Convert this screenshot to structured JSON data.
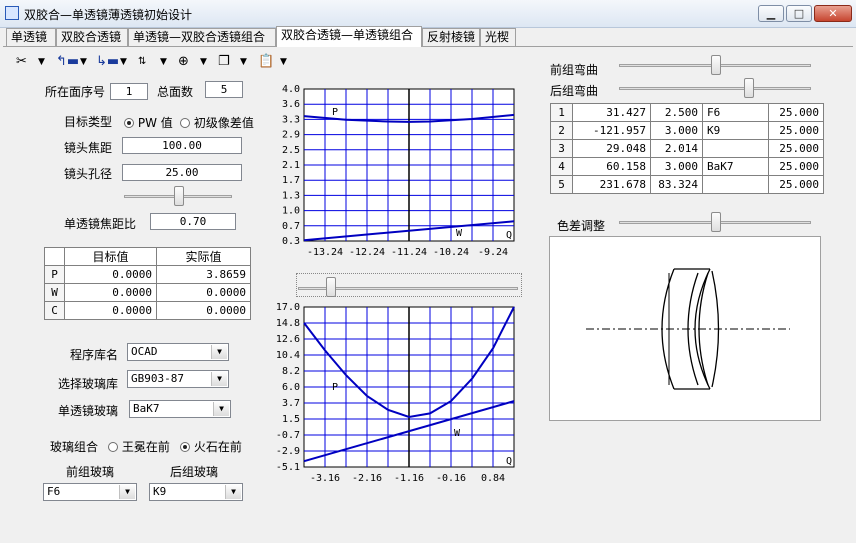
{
  "window": {
    "title": "双胶合—单透镜薄透镜初始设计",
    "minimize_label": "▁",
    "maximize_label": "□",
    "close_label": "✕"
  },
  "tabs": [
    {
      "label": "单透镜"
    },
    {
      "label": "双胶合透镜"
    },
    {
      "label": "单透镜—双胶合透镜组合"
    },
    {
      "label": "双胶合透镜—单透镜组合"
    },
    {
      "label": "反射棱镜"
    },
    {
      "label": "光楔"
    }
  ],
  "toolbar": {
    "icons": [
      "scissors-icon",
      "move-up-icon",
      "move-down-icon",
      "sort-icon",
      "zoom-icon",
      "copy-icon",
      "paste-icon"
    ]
  },
  "left": {
    "surface_index_label": "所在面序号",
    "surface_index_value": "1",
    "total_surfaces_label": "总面数",
    "total_surfaces_value": "5",
    "target_type_label": "目标类型",
    "target_type_options": [
      "PW 值",
      "初级像差值"
    ],
    "target_type_selected": 0,
    "focal_length_label": "镜头焦距",
    "focal_length_value": "100.00",
    "aperture_label": "镜头孔径",
    "aperture_value": "25.00",
    "aperture_slider_fraction": 0.55,
    "single_lens_ratio_label": "单透镜焦距比",
    "single_lens_ratio_value": "0.70",
    "pwc_table": {
      "headers": [
        "",
        "目标值",
        "实际值"
      ],
      "rows": [
        {
          "name": "P",
          "target": "0.0000",
          "actual": "3.8659"
        },
        {
          "name": "W",
          "target": "0.0000",
          "actual": "0.0000"
        },
        {
          "name": "C",
          "target": "0.0000",
          "actual": "0.0000"
        }
      ]
    },
    "program_library_label": "程序库名",
    "program_library_value": "OCAD",
    "glass_library_label": "选择玻璃库",
    "glass_library_value": "GB903-87",
    "single_glass_label": "单透镜玻璃",
    "single_glass_value": "BaK7",
    "glass_combo_label": "玻璃组合",
    "glass_combo_options": [
      "王冕在前",
      "火石在前"
    ],
    "glass_combo_selected": 1,
    "front_glass_label": "前组玻璃",
    "front_glass_value": "F6",
    "rear_glass_label": "后组玻璃",
    "rear_glass_value": "K9"
  },
  "right": {
    "front_bend_label": "前组弯曲",
    "front_bend_fraction": 0.5,
    "rear_bend_label": "后组弯曲",
    "rear_bend_fraction": 0.5,
    "lens_table": [
      {
        "index": "1",
        "radius": "31.427",
        "thickness": "2.500",
        "glass": "F6",
        "aperture": "25.000"
      },
      {
        "index": "2",
        "radius": "-121.957",
        "thickness": "3.000",
        "glass": "K9",
        "aperture": "25.000"
      },
      {
        "index": "3",
        "radius": "29.048",
        "thickness": "2.014",
        "glass": "",
        "aperture": "25.000"
      },
      {
        "index": "4",
        "radius": "60.158",
        "thickness": "3.000",
        "glass": "BaK7",
        "aperture": "25.000"
      },
      {
        "index": "5",
        "radius": "231.678",
        "thickness": "83.324",
        "glass": "",
        "aperture": "25.000"
      }
    ],
    "color_adjust_label": "色差调整",
    "color_adjust_fraction": 0.5,
    "middle_slider_fraction": 0.15
  },
  "chart_data": [
    {
      "type": "line",
      "x_ticks": [
        "-13.24",
        "-12.24",
        "-11.24",
        "-10.24",
        "-9.24"
      ],
      "y_ticks": [
        "4.0",
        "3.6",
        "3.3",
        "2.9",
        "2.5",
        "2.1",
        "1.7",
        "1.3",
        "1.0",
        "0.7",
        "0.3"
      ],
      "xlim": [
        -13.74,
        -8.74
      ],
      "ylim": [
        0.3,
        4.0
      ],
      "grid": true,
      "vertical_marker_x": -11.24,
      "labels": [
        "P",
        "W",
        "Q"
      ],
      "series": [
        {
          "name": "P",
          "x": [
            -13.74,
            -12.74,
            -11.74,
            -11.24,
            -10.74,
            -9.74,
            -8.74
          ],
          "y": [
            3.34,
            3.25,
            3.21,
            3.2,
            3.21,
            3.27,
            3.37
          ]
        },
        {
          "name": "W",
          "x": [
            -13.74,
            -8.74
          ],
          "y": [
            0.32,
            0.78
          ]
        }
      ]
    },
    {
      "type": "line",
      "x_ticks": [
        "-3.16",
        "-2.16",
        "-1.16",
        "-0.16",
        "0.84"
      ],
      "y_ticks": [
        "17.0",
        "14.8",
        "12.6",
        "10.4",
        "8.2",
        "6.0",
        "3.7",
        "1.5",
        "-0.7",
        "-2.9",
        "-5.1"
      ],
      "xlim": [
        -3.66,
        1.34
      ],
      "ylim": [
        -5.1,
        17.0
      ],
      "grid": true,
      "vertical_marker_x": -1.16,
      "labels": [
        "P",
        "W",
        "Q"
      ],
      "series": [
        {
          "name": "P",
          "x": [
            -3.66,
            -3.16,
            -2.66,
            -2.16,
            -1.66,
            -1.16,
            -0.66,
            -0.16,
            0.34,
            0.84,
            1.34
          ],
          "y": [
            14.8,
            11.0,
            7.6,
            4.7,
            2.8,
            1.8,
            2.3,
            4.0,
            7.1,
            11.3,
            17.0
          ]
        },
        {
          "name": "W",
          "x": [
            -3.66,
            1.34
          ],
          "y": [
            -4.3,
            4.0
          ]
        }
      ]
    }
  ]
}
